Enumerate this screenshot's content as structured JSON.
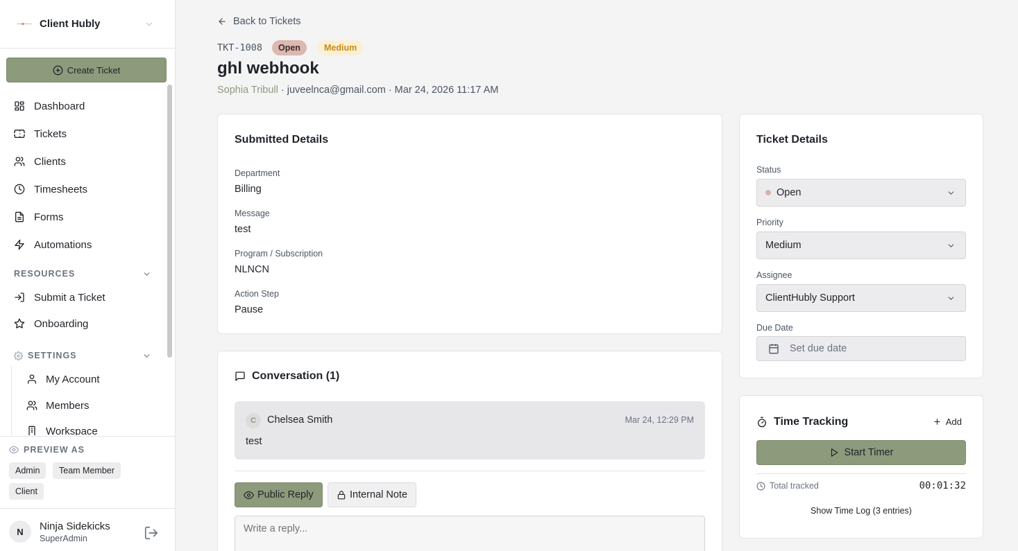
{
  "sidebar": {
    "brand": "Client Hubly",
    "create_label": "Create Ticket",
    "nav": [
      {
        "label": "Dashboard",
        "icon": "dashboard-icon"
      },
      {
        "label": "Tickets",
        "icon": "ticket-icon"
      },
      {
        "label": "Clients",
        "icon": "users-icon"
      },
      {
        "label": "Timesheets",
        "icon": "clock-icon"
      },
      {
        "label": "Forms",
        "icon": "document-icon"
      },
      {
        "label": "Automations",
        "icon": "bolt-icon"
      }
    ],
    "resources_label": "RESOURCES",
    "resources": [
      {
        "label": "Submit a Ticket",
        "icon": "login-icon"
      },
      {
        "label": "Onboarding",
        "icon": "star-icon"
      }
    ],
    "settings_label": "SETTINGS",
    "settings": [
      {
        "label": "My Account",
        "icon": "user-icon"
      },
      {
        "label": "Members",
        "icon": "users-icon"
      },
      {
        "label": "Workspace",
        "icon": "building-icon"
      }
    ],
    "preview_label": "PREVIEW AS",
    "preview_roles": [
      "Admin",
      "Team Member",
      "Client"
    ],
    "user": {
      "initial": "N",
      "name": "Ninja Sidekicks",
      "role": "SuperAdmin"
    }
  },
  "header": {
    "back_label": "Back to Tickets",
    "ticket_id": "TKT-1008",
    "status_badge": "Open",
    "priority_badge": "Medium",
    "title": "ghl webhook",
    "requester": "Sophia Tribull",
    "email": " · juveelnca@gmail.com · Mar 24, 2026 11:17 AM"
  },
  "submitted": {
    "title": "Submitted Details",
    "fields": [
      {
        "label": "Department",
        "value": "Billing"
      },
      {
        "label": "Message",
        "value": "test"
      },
      {
        "label": "Program / Subscription",
        "value": "NLNCN"
      },
      {
        "label": "Action Step",
        "value": "Pause"
      }
    ]
  },
  "conversation": {
    "title": "Conversation (1)",
    "messages": [
      {
        "initial": "C",
        "author": "Chelsea Smith",
        "time": "Mar 24, 12:29 PM",
        "body": "test"
      }
    ],
    "tabs": [
      "Public Reply",
      "Internal Note"
    ],
    "reply_placeholder": "Write a reply..."
  },
  "ticket_details": {
    "title": "Ticket Details",
    "status_label": "Status",
    "status_value": "Open",
    "priority_label": "Priority",
    "priority_value": "Medium",
    "assignee_label": "Assignee",
    "assignee_value": "ClientHubly Support",
    "due_label": "Due Date",
    "due_placeholder": "Set due date"
  },
  "time_tracking": {
    "title": "Time Tracking",
    "add_label": "Add",
    "start_label": "Start Timer",
    "total_label": "Total tracked",
    "total_value": "00:01:32",
    "log_label": "Show Time Log (3 entries)"
  },
  "colors": {
    "accent": "#8d9a7c",
    "status_open": "#dbb8b0",
    "priority_medium_bg": "#fbefd5",
    "priority_medium_text": "#c98b14"
  }
}
